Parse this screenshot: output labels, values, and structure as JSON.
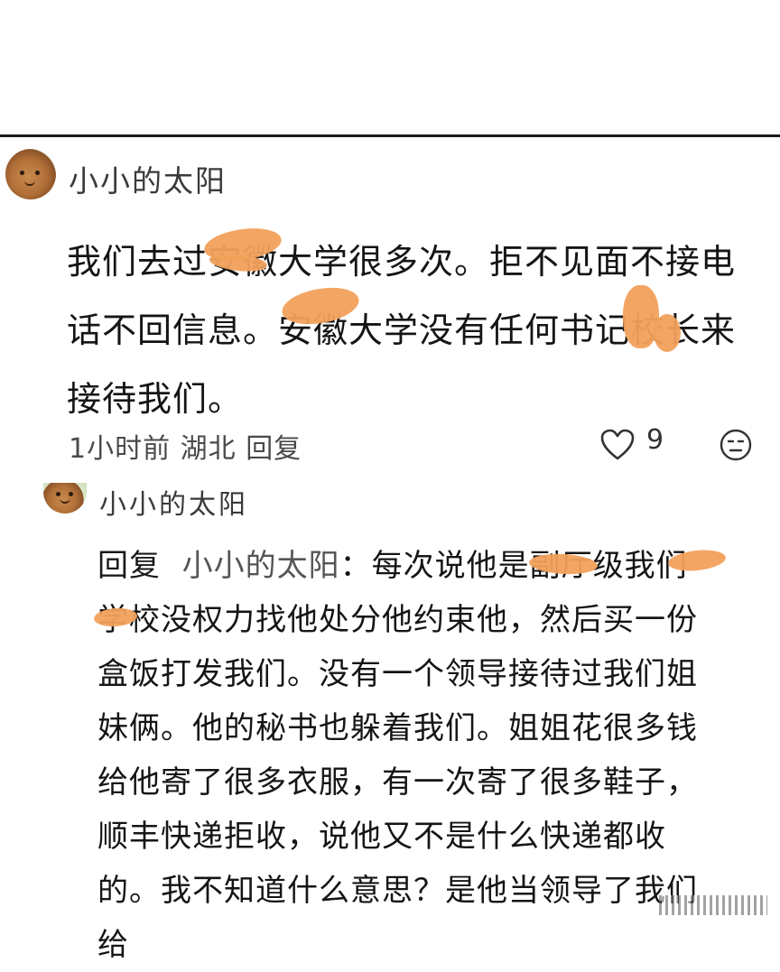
{
  "comment": {
    "username": "小小的太阳",
    "text": "我们去过安徽大学很多次。拒不见面不接电话不回信息。安徽大学没有任何书记校长来接待我们。",
    "time": "1小时前",
    "location": "湖北",
    "reply_label": "回复",
    "likes": "9",
    "like_icon": "heart-outline-icon",
    "emoji_icon": "expressionless-face-icon"
  },
  "reply": {
    "username": "小小的太阳",
    "prefix": "回复",
    "target": "小小的太阳",
    "text": "：每次说他是副厅级我们学校没权力找他处分他约束他，然后买一份盒饭打发我们。没有一个领导接待过我们姐妹俩。他的秘书也躲着我们。姐姐花很多钱给他寄了很多衣服，有一次寄了很多鞋子，顺丰快递拒收，说他又不是什么快递都收的。我不知道什么意思？是他当领导了我们给"
  },
  "colors": {
    "smudge": "#f2a15c",
    "divider": "#1a1a1a"
  }
}
